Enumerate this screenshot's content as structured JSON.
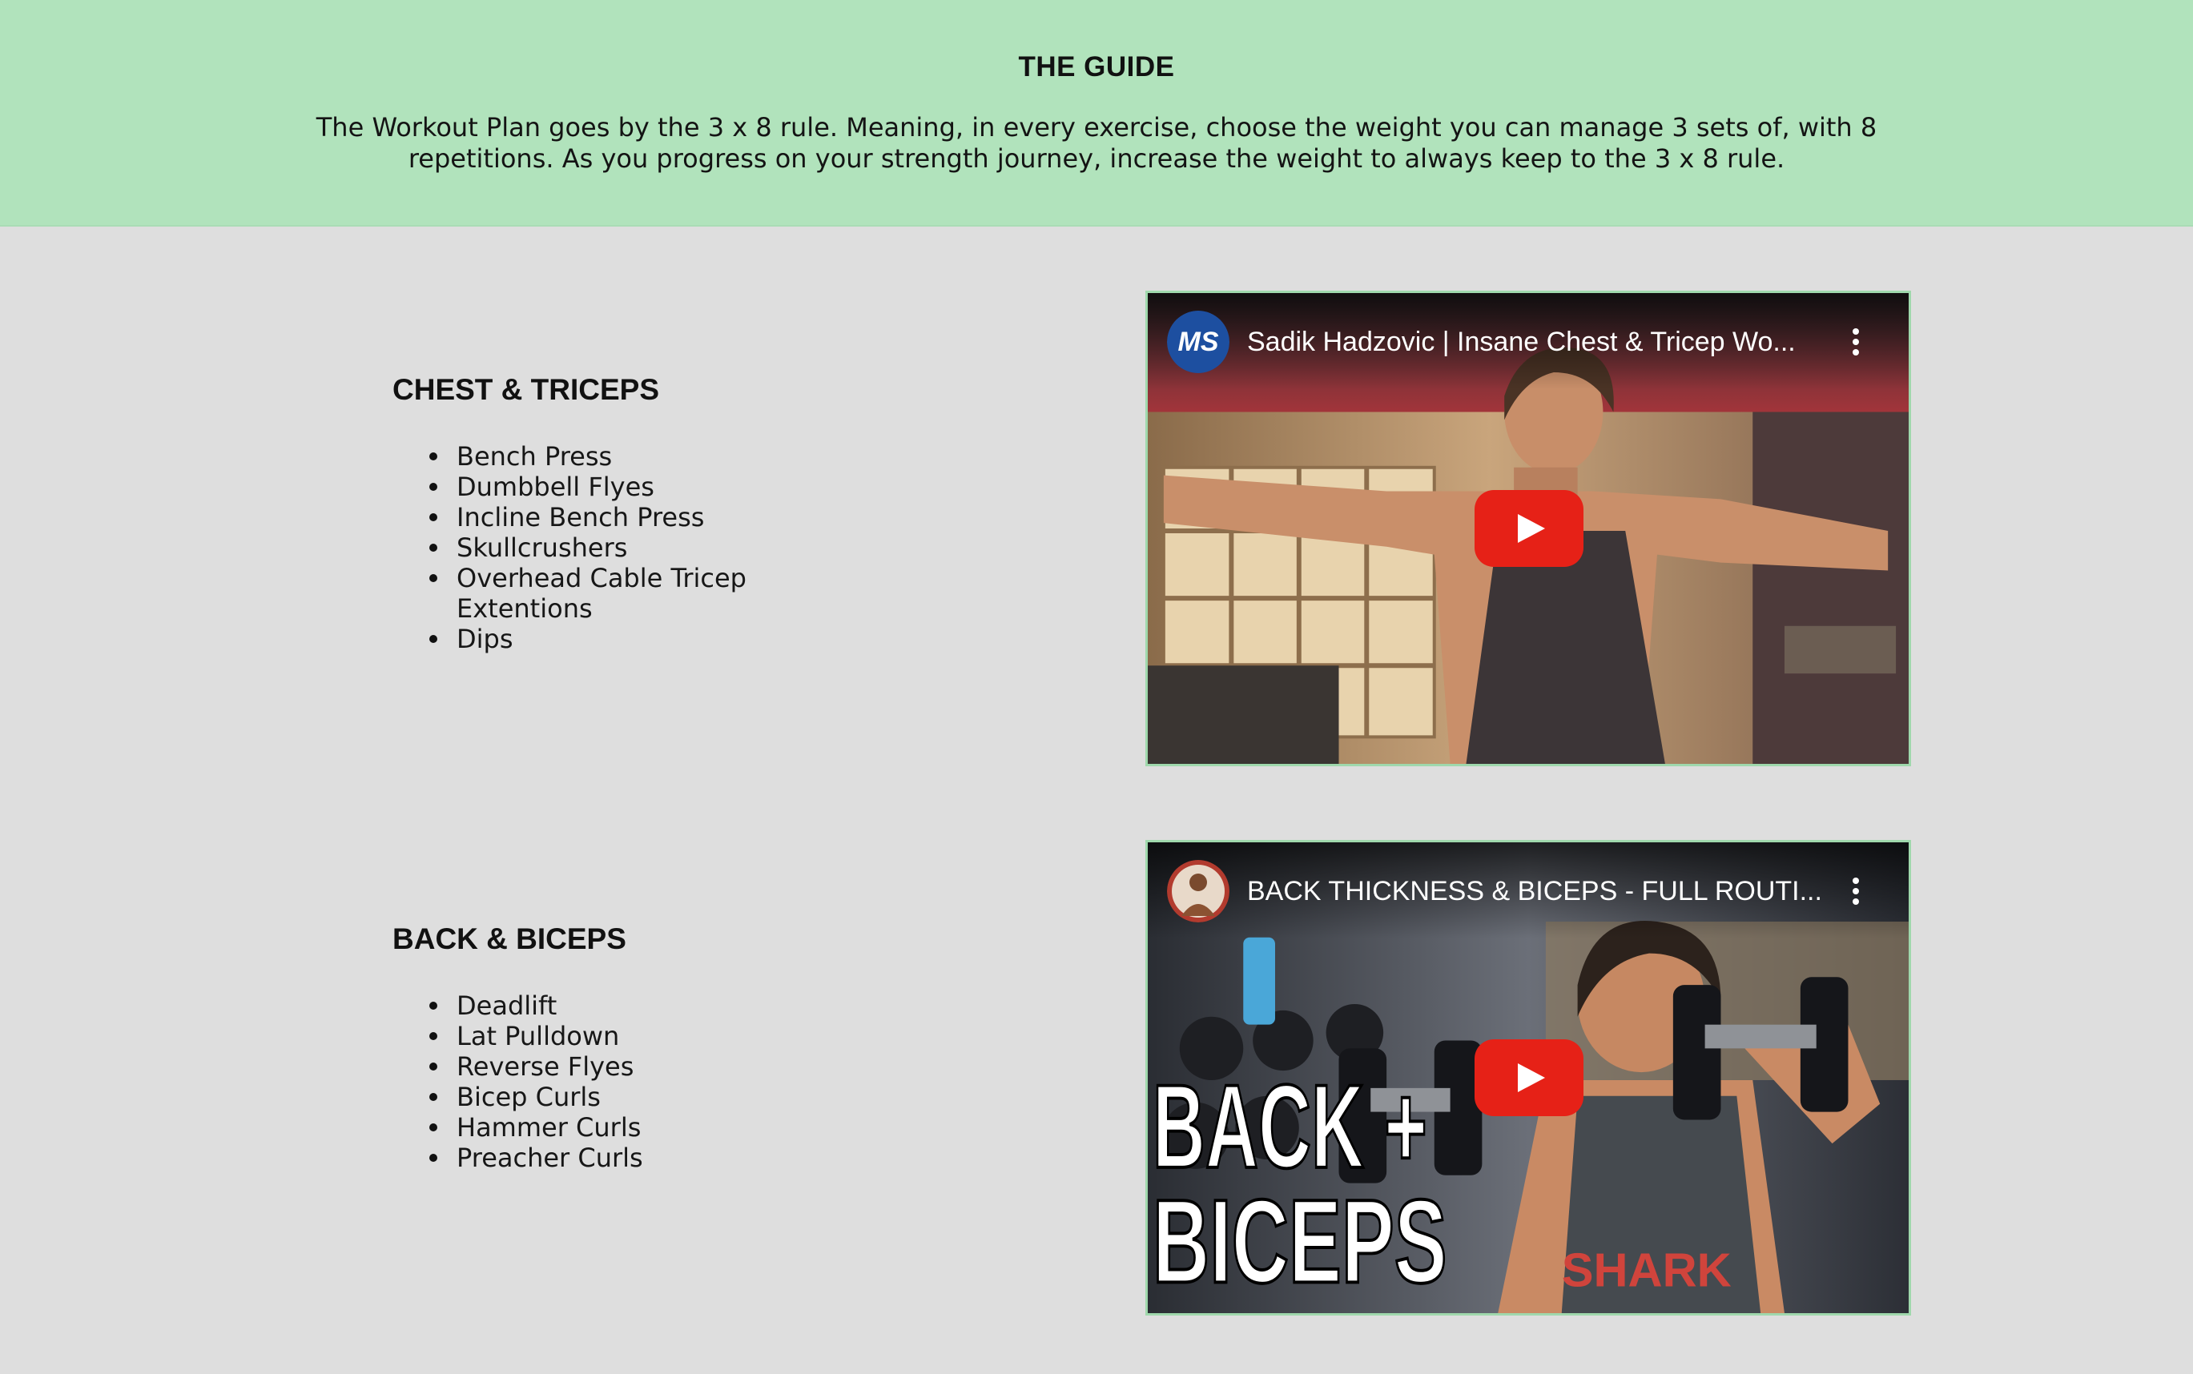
{
  "guide": {
    "title": "THE GUIDE",
    "text": "The Workout Plan goes by the 3 x 8 rule. Meaning, in every exercise, choose the weight you can manage 3 sets of, with 8 repetitions. As you progress on your strength journey, increase the weight to always keep to the 3 x 8 rule."
  },
  "sections": [
    {
      "title": "CHEST & TRICEPS",
      "exercises": [
        "Bench Press",
        "Dumbbell Flyes",
        "Incline Bench Press",
        "Skullcrushers",
        "Overhead Cable Tricep Extentions",
        "Dips"
      ],
      "video": {
        "title": "Sadik Hadzovic | Insane Chest & Tricep Wo...",
        "channel_badge": "MS",
        "channel_icon": "channel-logo-icon",
        "play_icon": "play-button-icon",
        "menu_icon": "more-vert-icon"
      }
    },
    {
      "title": "BACK & BICEPS",
      "exercises": [
        "Deadlift",
        "Lat Pulldown",
        "Reverse Flyes",
        "Bicep Curls",
        "Hammer Curls",
        "Preacher Curls"
      ],
      "video": {
        "title": "BACK THICKNESS & BICEPS - FULL ROUTI...",
        "overlay_line1": "BACK +",
        "overlay_line2": "BICEPS",
        "shirt_text": "SHARK",
        "channel_icon": "channel-avatar-icon",
        "play_icon": "play-button-icon",
        "menu_icon": "more-vert-icon"
      }
    }
  ],
  "colors": {
    "header_bg": "#b1e3bc",
    "page_bg": "#dedede",
    "video_border": "#9fd8ac",
    "play_red": "#e62117"
  }
}
